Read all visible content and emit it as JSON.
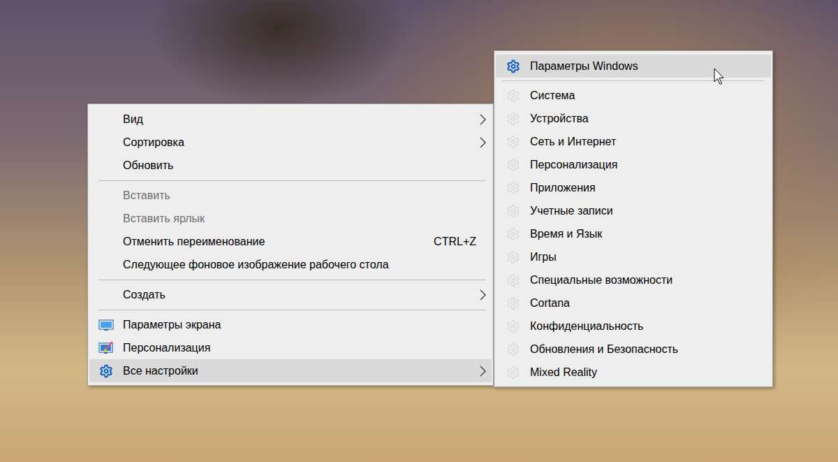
{
  "context_menu": {
    "items": [
      {
        "kind": "item",
        "label": "Вид",
        "shortcut": "",
        "submenu": true,
        "disabled": false,
        "selected": false,
        "icon": "none"
      },
      {
        "kind": "item",
        "label": "Сортировка",
        "shortcut": "",
        "submenu": true,
        "disabled": false,
        "selected": false,
        "icon": "none"
      },
      {
        "kind": "item",
        "label": "Обновить",
        "shortcut": "",
        "submenu": false,
        "disabled": false,
        "selected": false,
        "icon": "none"
      },
      {
        "kind": "separator"
      },
      {
        "kind": "item",
        "label": "Вставить",
        "shortcut": "",
        "submenu": false,
        "disabled": true,
        "selected": false,
        "icon": "none"
      },
      {
        "kind": "item",
        "label": "Вставить ярлык",
        "shortcut": "",
        "submenu": false,
        "disabled": true,
        "selected": false,
        "icon": "none"
      },
      {
        "kind": "item",
        "label": "Отменить переименование",
        "shortcut": "CTRL+Z",
        "submenu": false,
        "disabled": false,
        "selected": false,
        "icon": "none"
      },
      {
        "kind": "item",
        "label": "Следующее фоновое изображение рабочего стола",
        "shortcut": "",
        "submenu": false,
        "disabled": false,
        "selected": false,
        "icon": "none"
      },
      {
        "kind": "separator"
      },
      {
        "kind": "item",
        "label": "Создать",
        "shortcut": "",
        "submenu": true,
        "disabled": false,
        "selected": false,
        "icon": "none"
      },
      {
        "kind": "separator"
      },
      {
        "kind": "item",
        "label": "Параметры экрана",
        "shortcut": "",
        "submenu": false,
        "disabled": false,
        "selected": false,
        "icon": "display"
      },
      {
        "kind": "item",
        "label": "Персонализация",
        "shortcut": "",
        "submenu": false,
        "disabled": false,
        "selected": false,
        "icon": "personalize"
      },
      {
        "kind": "item",
        "label": "Все настройки",
        "shortcut": "",
        "submenu": true,
        "disabled": false,
        "selected": true,
        "icon": "gear"
      }
    ]
  },
  "submenu": {
    "items": [
      {
        "kind": "item",
        "label": "Параметры Windows",
        "selected": true,
        "icon": "gear-color"
      },
      {
        "kind": "separator"
      },
      {
        "kind": "item",
        "label": "Система",
        "selected": false,
        "icon": "gear-faint"
      },
      {
        "kind": "item",
        "label": "Устройства",
        "selected": false,
        "icon": "gear-faint"
      },
      {
        "kind": "item",
        "label": "Сеть и Интернет",
        "selected": false,
        "icon": "gear-faint"
      },
      {
        "kind": "item",
        "label": "Персонализация",
        "selected": false,
        "icon": "gear-faint"
      },
      {
        "kind": "item",
        "label": "Приложения",
        "selected": false,
        "icon": "gear-faint"
      },
      {
        "kind": "item",
        "label": "Учетные записи",
        "selected": false,
        "icon": "gear-faint"
      },
      {
        "kind": "item",
        "label": "Время и Язык",
        "selected": false,
        "icon": "gear-faint"
      },
      {
        "kind": "item",
        "label": "Игры",
        "selected": false,
        "icon": "gear-faint"
      },
      {
        "kind": "item",
        "label": "Специальные возможности",
        "selected": false,
        "icon": "gear-faint"
      },
      {
        "kind": "item",
        "label": "Cortana",
        "selected": false,
        "icon": "gear-faint"
      },
      {
        "kind": "item",
        "label": "Конфиденциальность",
        "selected": false,
        "icon": "gear-faint"
      },
      {
        "kind": "item",
        "label": "Обновления и Безопасность",
        "selected": false,
        "icon": "gear-faint"
      },
      {
        "kind": "item",
        "label": "Mixed Reality",
        "selected": false,
        "icon": "gear-faint"
      }
    ]
  }
}
